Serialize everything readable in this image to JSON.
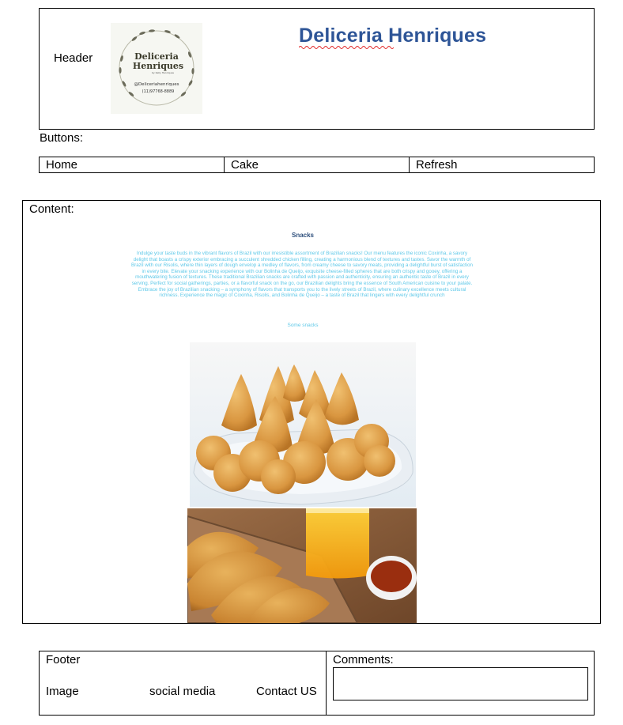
{
  "header": {
    "label": "Header",
    "site_title": "Deliceria Henriques",
    "logo": {
      "name": "Deliceria",
      "name2": "Henriques",
      "by": "by Kelly Henriques",
      "handle": "@Deliceriahenriques",
      "phone": "(11)97768-8889"
    }
  },
  "buttons": {
    "label": "Buttons:",
    "items": [
      "Home",
      "Cake",
      "Refresh"
    ]
  },
  "content": {
    "label": "Content:",
    "heading": "Snacks",
    "description": "Indulge your taste buds in the vibrant flavors of Brazil with our irresistible assortment of Brazilian snacks! Our menu features the iconic Coxinha, a savory delight that boasts a crispy exterior embracing a succulent shredded chicken filling, creating a harmonious blend of textures and tastes. Savor the warmth of Brazil with our Risolis, where thin layers of dough envelop a medley of flavors, from creamy cheese to savory meats, providing a delightful burst of satisfaction in every bite. Elevate your snacking experience with our Bolinha de Queijo, exquisite cheese-filled spheres that are both crispy and gooey, offering a mouthwatering fusion of textures. These traditional Brazilian snacks are crafted with passion and authenticity, ensuring an authentic taste of Brazil in every serving. Perfect for social gatherings, parties, or a flavorful snack on the go, our Brazilian delights bring the essence of South American cuisine to your palate. Embrace the joy of Brazilian snacking – a symphony of flavors that transports you to the lively streets of Brazil, where culinary excellence meets cultural richness. Experience the magic of Coxinha, Risolis, and Bolinha de Queijo – a taste of Brazil that lingers with every delightful crunch",
    "caption": "Some snacks"
  },
  "footer": {
    "label": "Footer",
    "image": "Image",
    "social": "social media",
    "contact": "Contact US",
    "comments_label": "Comments:"
  },
  "colors": {
    "title": "#2e5597",
    "description": "#5ec8e8",
    "heading": "#2e4f7c"
  }
}
